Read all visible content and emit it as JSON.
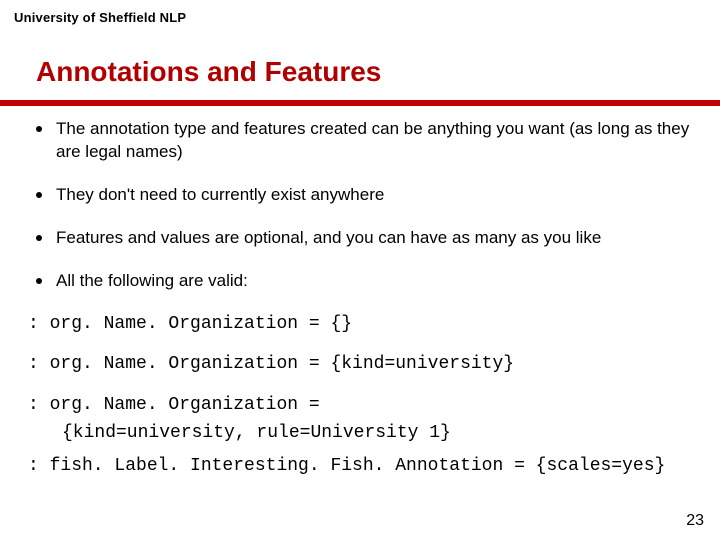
{
  "affiliation": "University of Sheffield NLP",
  "title": "Annotations and Features",
  "bullets": [
    "The annotation type and features created can be anything you want (as long as they are legal names)",
    "They don't need to currently exist anywhere",
    "Features and values are optional, and you can have as many as you like",
    "All the following are valid:"
  ],
  "code": {
    "l1": ": org. Name. Organization = {}",
    "l2": ": org. Name. Organization = {kind=university}",
    "l3": ": org. Name. Organization =",
    "l4": "{kind=university, rule=University 1}",
    "l5": ": fish. Label. Interesting. Fish. Annotation = {scales=yes}"
  },
  "pagenum": "23"
}
